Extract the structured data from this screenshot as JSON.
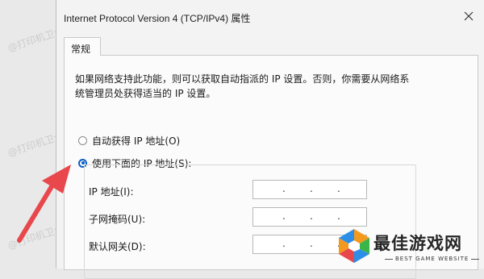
{
  "dialog": {
    "title": "Internet Protocol Version 4 (TCP/IPv4) 属性",
    "tab_general": "常规",
    "description": "如果网络支持此功能，则可以获取自动指派的 IP 设置。否则，你需要从网络系统管理员处获得适当的 IP 设置。",
    "radio_auto_ip": "自动获得 IP 地址(O)",
    "radio_manual_ip": "使用下面的 IP 地址(S):",
    "selected_option": "manual",
    "fields": [
      {
        "label": "IP 地址(I):",
        "value": ". . ."
      },
      {
        "label": "子网掩码(U):",
        "value": ". . ."
      },
      {
        "label": "默认网关(D):",
        "value": ". . ."
      }
    ]
  },
  "watermark": {
    "text": "@打印机卫士"
  },
  "logo": {
    "title": "最佳游戏网",
    "subtitle": "BEST GAME WEBSITE"
  },
  "colors": {
    "accent": "#0a5cc2",
    "arrow": "#e8474b",
    "logo_orange": "#f39a1e",
    "logo_green": "#3ab54a",
    "logo_blue": "#2d8ee8",
    "logo_red": "#e8474b"
  },
  "icons": {
    "close": "close-icon",
    "arrow": "red-arrow-icon"
  }
}
